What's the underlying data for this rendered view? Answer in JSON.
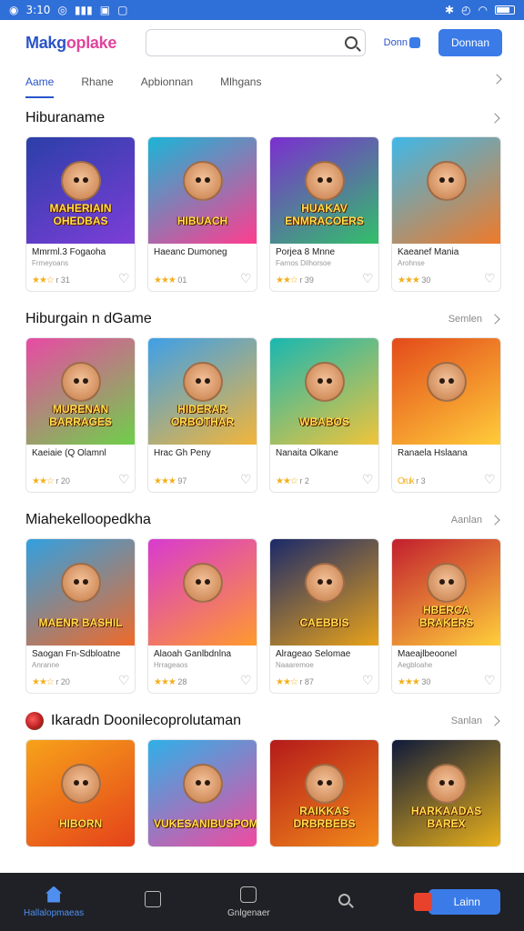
{
  "status_bar": {
    "time": "3:10",
    "signal": "▮▮▮"
  },
  "header": {
    "logo_main": "Makg",
    "logo_accent": "oplake",
    "search_placeholder": "",
    "link_label": "Donn",
    "cta_label": "Donnan"
  },
  "tabs": [
    {
      "label": "Aame",
      "active": true
    },
    {
      "label": "Rhane",
      "active": false
    },
    {
      "label": "Apbionnan",
      "active": false
    },
    {
      "label": "Mlhgans",
      "active": false
    }
  ],
  "sections": [
    {
      "title": "Hiburaname",
      "more": "",
      "cards": [
        {
          "name": "Mmrml.3 Fogaoha",
          "sub": "Frmeyoans",
          "rating": "★★☆",
          "count": "r 31",
          "thumb_text": "MAHERIAIN OHEDBAS",
          "bg": [
            "#2b3fa8",
            "#7d3ed8"
          ]
        },
        {
          "name": "Haeanc Dumoneg",
          "sub": "",
          "rating": "★★★",
          "count": "01",
          "thumb_text": "HIBUACH",
          "bg": [
            "#1bb5d6",
            "#ff3d8f"
          ]
        },
        {
          "name": "Porjea 8 Mnne",
          "sub": "Farnos Dilhorsoe",
          "rating": "★★☆",
          "count": "r 39",
          "thumb_text": "HUAKAV ENMRACOERS",
          "bg": [
            "#7b2fd0",
            "#32c06a"
          ]
        },
        {
          "name": "Kaeanef Mania",
          "sub": "Arohnse",
          "rating": "★★★",
          "count": "30",
          "thumb_text": "",
          "bg": [
            "#3fb8e8",
            "#ef7a2a"
          ]
        }
      ]
    },
    {
      "title": "Hiburgain n dGame",
      "more": "Semlen",
      "cards": [
        {
          "name": "Kaeiaie (Q Olamnl",
          "sub": "",
          "rating": "★★☆",
          "count": "r 20",
          "thumb_text": "MURENAN BARRAGES",
          "bg": [
            "#e84aa5",
            "#6fcf4a"
          ]
        },
        {
          "name": "Hrac Gh Peny",
          "sub": "",
          "rating": "★★★",
          "count": "97",
          "thumb_text": "HIDERAR ORBOTHAR",
          "bg": [
            "#3ea0e8",
            "#f2b53a"
          ]
        },
        {
          "name": "Nanaita Olkane",
          "sub": "",
          "rating": "★★☆",
          "count": "r 2",
          "thumb_text": "WBABOS",
          "bg": [
            "#19b7b1",
            "#f0c43a"
          ]
        },
        {
          "name": "Ranaela Hslaana",
          "sub": "",
          "rating": "Oruk",
          "count": "r 3",
          "thumb_text": "",
          "bg": [
            "#e34a1a",
            "#ffcc3a"
          ]
        }
      ]
    },
    {
      "title": "Miahekelloopedkha",
      "more": "Aanlan",
      "cards": [
        {
          "name": "Saogan Fn-Sdbloatne",
          "sub": "Anranne",
          "rating": "★★☆",
          "count": "r 20",
          "thumb_text": "MAENR BASHIL",
          "bg": [
            "#32a0e0",
            "#ef6a2a"
          ]
        },
        {
          "name": "Alaoah Ganlbdnlna",
          "sub": "Hrrageaos",
          "rating": "★★★",
          "count": "28",
          "thumb_text": "",
          "bg": [
            "#d83ad0",
            "#ff9a2e"
          ]
        },
        {
          "name": "Alrageao Selomae",
          "sub": "Naaaremoe",
          "rating": "★★☆",
          "count": "r 87",
          "thumb_text": "CAEBBIS",
          "bg": [
            "#1b2a6a",
            "#e8a21a"
          ]
        },
        {
          "name": "Maeajlbeoonel",
          "sub": "Aegbloahe",
          "rating": "★★★",
          "count": "30",
          "thumb_text": "HBERCA BRAKERS",
          "bg": [
            "#c21e2e",
            "#ffcf3a"
          ]
        }
      ]
    },
    {
      "title": "Ikaradn Doonilecoprolutaman",
      "more": "Sanlan",
      "has_icon": true,
      "cards": [
        {
          "name": "",
          "sub": "",
          "rating": "",
          "count": "",
          "thumb_text": "HIBORN",
          "bg": [
            "#f7a21a",
            "#e4421a"
          ]
        },
        {
          "name": "",
          "sub": "",
          "rating": "",
          "count": "",
          "thumb_text": "VUKESANIBUSPOMAN",
          "bg": [
            "#2fb0e8",
            "#f04aa0"
          ]
        },
        {
          "name": "",
          "sub": "",
          "rating": "",
          "count": "",
          "thumb_text": "RAIKKAS DRBRBEBS",
          "bg": [
            "#b41a1a",
            "#f28a1a"
          ]
        },
        {
          "name": "",
          "sub": "",
          "rating": "",
          "count": "",
          "thumb_text": "HARKAADAS BAREX",
          "bg": [
            "#0f1a3a",
            "#e8b01a"
          ]
        }
      ]
    }
  ],
  "bottom_nav": [
    {
      "label": "Hallalopmaeas",
      "icon": "home-icon",
      "active": true
    },
    {
      "label": "",
      "icon": "box-icon",
      "active": false
    },
    {
      "label": "Gnlgenaer",
      "icon": "bag-icon",
      "active": false
    },
    {
      "label": "",
      "icon": "search-icon",
      "active": false
    }
  ],
  "bottom_cta": {
    "label": "Lainn",
    "color": "#3a7be8"
  }
}
